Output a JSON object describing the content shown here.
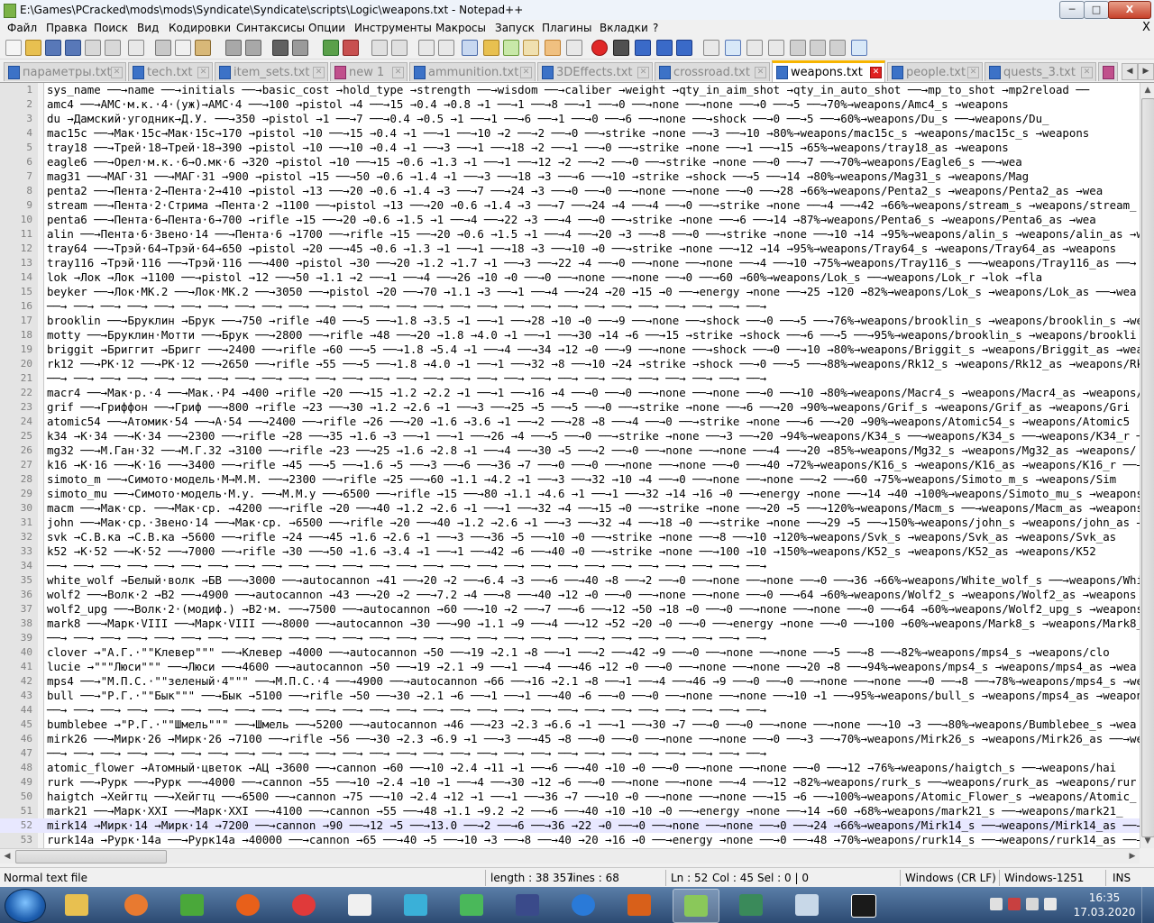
{
  "window": {
    "title": "E:\\Games\\PCracked\\mods\\mods\\Syndicate\\Syndicate\\scripts\\Logic\\weapons.txt - Notepad++",
    "min_label": "─",
    "max_label": "□",
    "close_label": "X"
  },
  "menu": [
    "Файл",
    "Правка",
    "Поиск",
    "Вид",
    "Кодировки",
    "Синтаксисы",
    "Опции",
    "Инструменты",
    "Макросы",
    "Запуск",
    "Плагины",
    "Вкладки",
    "?"
  ],
  "menu_close": "X",
  "tabs": [
    {
      "label": "параметры.txt",
      "modified": false,
      "active": false
    },
    {
      "label": "tech.txt",
      "modified": false,
      "active": false
    },
    {
      "label": "item_sets.txt",
      "modified": false,
      "active": false
    },
    {
      "label": "new 1",
      "modified": true,
      "active": false
    },
    {
      "label": "ammunition.txt",
      "modified": false,
      "active": false
    },
    {
      "label": "3DEffects.txt",
      "modified": false,
      "active": false
    },
    {
      "label": "crossroad.txt",
      "modified": false,
      "active": false
    },
    {
      "label": "weapons.txt",
      "modified": false,
      "active": true
    },
    {
      "label": "people.txt",
      "modified": false,
      "active": false
    },
    {
      "label": "quests_3.txt",
      "modified": false,
      "active": false
    }
  ],
  "lines": [
    "sys_name ──→name ──→initials ──→basic_cost →hold_type →strength ──→wisdom ──→caliber →weight →qty_in_aim_shot →qty_in_auto_shot ──→mp_to_shot →mp2reload ──",
    "amc4 ──→AMC·м.к.·4·(уж)→AMC·4 ──→100 →pistol →4 ──→15 →0.4 →0.8 →1 ──→1 ──→8 ──→1 ──→0 ──→none ──→none ──→0 ──→5 ──→70%→weapons/Amc4_s →weapons",
    "du →Дамский·угодник→Д.У. ──→350 →pistol →1 ──→7 ──→0.4 →0.5 →1 ──→1 ──→6 ──→1 ──→0 ──→6 ──→none ──→shock ──→0 ──→5 ──→60%→weapons/Du_s ──→weapons/Du_",
    "mac15c ──→Мак·15с→Мак·15с→170 →pistol →10 ──→15 →0.4 →1 ──→1 ──→10 →2 ──→2 ──→0 ──→strike →none ──→3 ──→10 →80%→weapons/mac15c_s →weapons/mac15c_s →weapons",
    "tray18 ──→Трей·18→Трей·18→390 →pistol →10 ──→10 →0.4 →1 ──→3 ──→1 ──→18 →2 ──→1 ──→0 ──→strike →none ──→1 ──→15 →65%→weapons/tray18_as →weapons",
    "eagle6 ──→Орел·м.к.·6→О.мк·6 →320 →pistol →10 ──→15 →0.6 →1.3 →1 ──→1 ──→12 →2 ──→2 ──→0 ──→strike →none ──→0 ──→7 ──→70%→weapons/Eagle6_s ──→wea",
    "mag31 ──→МАГ·31 ──→МАГ·31 →900 →pistol →15 ──→50 →0.6 →1.4 →1 ──→3 ──→18 →3 ──→6 ──→10 →strike →shock ──→5 ──→14 →80%→weapons/Mag31_s →weapons/Mag",
    "penta2 ──→Пента·2→Пента·2→410 →pistol →13 ──→20 →0.6 →1.4 →3 ──→7 ──→24 →3 ──→0 ──→0 ──→none ──→none ──→0 ──→28 →66%→weapons/Penta2_s →weapons/Penta2_as →wea",
    "stream ──→Пента·2·Стрима →Пента·2 →1100 ──→pistol →13 ──→20 →0.6 →1.4 →3 ──→7 ──→24 →4 ──→4 ──→0 ──→strike →none ──→4 ──→42 →66%→weapons/stream_s →weapons/stream_",
    "penta6 ──→Пента·6→Пента·6→700 →rifle →15 ──→20 →0.6 →1.5 →1 ──→4 ──→22 →3 ──→4 ──→0 ──→strike →none ──→6 ──→14 →87%→weapons/Penta6_s →weapons/Penta6_as →wea",
    "alin ──→Пента·6·Звено·14 ──→Пента·6 →1700 ──→rifle →15 ──→20 →0.6 →1.5 →1 ──→4 ──→20 →3 ──→8 ──→0 ──→strike →none ──→10 →14 →95%→weapons/alin_s →weapons/alin_as →wea",
    "tray64 ──→Трэй·64→Трэй·64→650 →pistol →20 ──→45 →0.6 →1.3 →1 ──→1 ──→18 →3 ──→10 →0 ──→strike →none ──→12 →14 →95%→weapons/Tray64_s →weapons/Tray64_as →weapons",
    "tray116 →Трэй·116 ──→Трэй·116 ──→400 →pistol →30 ──→20 →1.2 →1.7 →1 ──→3 ──→22 →4 ──→0 ──→none ──→none ──→4 ──→10 →75%→weapons/Tray116_s ──→weapons/Tray116_as ──→",
    "lok →Лок →Лок →1100 ──→pistol →12 ──→50 →1.1 →2 ──→1 ──→4 ──→26 →10 →0 ──→0 ──→none ──→none ──→0 ──→60 →60%→weapons/Lok_s ──→weapons/Lok_r →lok →fla",
    "beyker ──→Лок·МК.2 ──→Лок·МК.2 ──→3050 ──→pistol →20 ──→70 →1.1 →3 ──→1 ──→4 ──→24 →20 →15 →0 ──→energy →none ──→25 →120 →82%→weapons/Lok_s →weapons/Lok_as ──→wea",
    "──→ ──→ ──→ ──→ ──→ ──→ ──→ ──→ ──→ ──→ ──→ ──→ ──→ ──→ ──→ ──→ ──→ ──→ ──→ ──→ ──→ ──→ ──→ ──→ ──→ ──→ ──→",
    "brooklin ──→Бруклин →Брук ──→750 →rifle →40 ──→5 ──→1.8 →3.5 →1 ──→1 ──→28 →10 →0 ──→9 ──→none ──→shock ──→0 ──→5 ──→76%→weapons/brooklin_s →weapons/brooklin_s →wea",
    "motty ──→Бруклин·Мотти ──→Брук ──→2800 ──→rifle →48 ──→20 →1.8 →4.0 →1 ──→1 ──→30 →14 →6 ──→15 →strike →shock ──→6 ──→5 ──→95%→weapons/brooklin_s →weapons/brookli",
    "briggit →Бриггит →Бригг ──→2400 ──→rifle →60 ──→5 ──→1.8 →5.4 →1 ──→4 ──→34 →12 →0 ──→9 ──→none ──→shock ──→0 ──→10 →80%→weapons/Briggit_s →weapons/Briggit_as →wea",
    "rk12 ──→РК·12 ──→РК·12 ──→2650 ──→rifle →55 ──→5 ──→1.8 →4.0 →1 ──→1 ──→32 →8 ──→10 →24 →strike →shock ──→0 ──→5 ──→88%→weapons/Rk12_s →weapons/Rk12_as →weapons/Rk1",
    "──→ ──→ ──→ ──→ ──→ ──→ ──→ ──→ ──→ ──→ ──→ ──→ ──→ ──→ ──→ ──→ ──→ ──→ ──→ ──→ ──→ ──→ ──→ ──→ ──→ ──→ ──→",
    "macr4 ──→Мак·р.·4 ──→Мак.·P4 →400 →rifle →20 ──→15 →1.2 →2.2 →1 ──→1 ──→16 →4 ──→0 ──→0 ──→none ──→none ──→0 ──→10 →80%→weapons/Macr4_s →weapons/Macr4_as →weapons/Mac",
    "grif ──→Гриффон ──→Гриф ──→800 →rifle →23 ──→30 →1.2 →2.6 →1 ──→3 ──→25 →5 ──→5 ──→0 ──→strike →none ──→6 ──→20 →90%→weapons/Grif_s →weapons/Grif_as →weapons/Gri",
    "atomic54 ──→Атомик·54 ──→А·54 ──→2400 ──→rifle →26 ──→20 →1.6 →3.6 →1 ──→2 ──→28 →8 ──→4 ──→0 ──→strike →none ──→6 ──→20 →90%→weapons/Atomic54_s →weapons/Atomic5",
    "k34 →К·34 ──→К·34 ──→2300 ──→rifle →28 ──→35 →1.6 →3 ──→1 ──→1 ──→26 →4 ──→5 ──→0 ──→strike →none ──→3 ──→20 →94%→weapons/K34_s ──→weapons/K34_s ──→weapons/K34_r ──→",
    "mg32 ──→М.Ган·32 ──→М.Г.32 →3100 ──→rifle →23 ──→25 →1.6 →2.8 →1 ──→4 ──→30 →5 ──→2 ──→0 ──→none ──→none ──→4 ──→20 →85%→weapons/Mg32_s →weapons/Mg32_as →weapons/",
    "k16 →К·16 ──→К·16 ──→3400 ──→rifle →45 ──→5 ──→1.6 →5 ──→3 ──→6 ──→36 →7 ──→0 ──→0 ──→none ──→none ──→0 ──→40 →72%→weapons/K16_s →weapons/K16_as →weapons/K16_r ──→",
    "simoto_m ──→Симото·модель·М→М.М. ──→2300 ──→rifle →25 ──→60 →1.1 →4.2 →1 ──→3 ──→32 →10 →4 ──→0 ──→none ──→none ──→2 ──→60 →75%→weapons/Simoto_m_s →weapons/Sim",
    "simoto_mu ──→Симото·модель·М.у. ──→М.М.у ──→6500 ──→rifle →15 ──→80 →1.1 →4.6 →1 ──→1 ──→32 →14 →16 →0 ──→energy →none ──→14 →40 →100%→weapons/Simoto_mu_s →weapons",
    "macm ──→Мак·ср. ──→Мак·ср. →4200 ──→rifle →20 ──→40 →1.2 →2.6 →1 ──→1 ──→32 →4 ──→15 →0 ──→strike →none ──→20 →5 ──→120%→weapons/Macm_s ──→weapons/Macm_as →weapons",
    "john ──→Мак·ср.·Звено·14 ──→Мак·ср. →6500 ──→rifle →20 ──→40 →1.2 →2.6 →1 ──→3 ──→32 →4 ──→18 →0 ──→strike →none ──→29 →5 ──→150%→weapons/john_s →weapons/john_as →weapons/joh",
    "svk →С.В.ка →С.В.ка →5600 ──→rifle →24 ──→45 →1.6 →2.6 →1 ──→3 ──→36 →5 ──→10 →0 ──→strike →none ──→8 ──→10 →120%→weapons/Svk_s →weapons/Svk_as →weapons/Svk_as",
    "k52 →К·52 ──→К·52 ──→7000 ──→rifle →30 ──→50 →1.6 →3.4 →1 ──→1 ──→42 →6 ──→40 →0 ──→strike →none ──→100 →10 →150%→weapons/K52_s →weapons/K52_as →weapons/K52",
    "──→ ──→ ──→ ──→ ──→ ──→ ──→ ──→ ──→ ──→ ──→ ──→ ──→ ──→ ──→ ──→ ──→ ──→ ──→ ──→ ──→ ──→ ──→ ──→ ──→ ──→ ──→",
    "white_wolf →Белый·волк →БВ ──→3000 ──→autocannon →41 ──→20 →2 ──→6.4 →3 ──→6 ──→40 →8 ──→2 ──→0 ──→none ──→none ──→0 ──→36 →66%→weapons/White_wolf_s ──→weapons/Whi",
    "wolf2 ──→Волк·2 →B2 ──→4900 ──→autocannon →43 ──→20 →2 ──→7.2 →4 ──→8 ──→40 →12 →0 ──→0 ──→none ──→none ──→0 ──→64 →60%→weapons/Wolf2_s →weapons/Wolf2_as →weapons",
    "wolf2_upg ──→Волк·2·(модиф.) →В2·м. ──→7500 ──→autocannon →60 ──→10 →2 ──→7 ──→6 ──→12 →50 →18 →0 ──→0 ──→none ──→none ──→0 ──→64 →60%→weapons/Wolf2_upg_s →weapons",
    "mark8 ──→Марк·VIII ──→Марк·VIII ──→8000 ──→autocannon →30 ──→90 →1.1 →9 ──→4 ──→12 →52 →20 →0 ──→0 ──→energy →none ──→0 ──→100 →60%→weapons/Mark8_s →weapons/Mark8_a",
    "──→ ──→ ──→ ──→ ──→ ──→ ──→ ──→ ──→ ──→ ──→ ──→ ──→ ──→ ──→ ──→ ──→ ──→ ──→ ──→ ──→ ──→ ──→ ──→ ──→ ──→ ──→",
    "clover →\"А.Г.·\"\"Клевер\"\"\" ──→Клевер →4000 ──→autocannon →50 ──→19 →2.1 →8 ──→1 ──→2 ──→42 →9 ──→0 ──→none ──→none ──→5 ──→8 ──→82%→weapons/mps4_s →weapons/clo",
    "lucie →\"\"\"Люси\"\"\" ──→Люси ──→4600 ──→autocannon →50 ──→19 →2.1 →9 ──→1 ──→4 ──→46 →12 →0 ──→0 ──→none ──→none ──→20 →8 ──→94%→weapons/mps4_s →weapons/mps4_as →wea",
    "mps4 ──→\"М.П.С.·\"\"зеленый·4\"\"\" ──→М.П.С.·4 ──→4900 ──→autocannon →66 ──→16 →2.1 →8 ──→1 ──→4 ──→46 →9 ──→0 ──→0 ──→none ──→none ──→0 ──→8 ──→78%→weapons/mps4_s →wea",
    "bull ──→\"Р.Г.·\"\"Бык\"\"\" ──→Бык →5100 ──→rifle →50 ──→30 →2.1 →6 ──→1 ──→1 ──→40 →6 ──→0 ──→0 ──→none ──→none ──→10 →1 ──→95%→weapons/bull_s →weapons/mps4_as →weapons",
    "──→ ──→ ──→ ──→ ──→ ──→ ──→ ──→ ──→ ──→ ──→ ──→ ──→ ──→ ──→ ──→ ──→ ──→ ──→ ──→ ──→ ──→ ──→ ──→ ──→ ──→ ──→",
    "bumblebee →\"Р.Г.·\"\"Шмель\"\"\" ──→Шмель ──→5200 ──→autocannon →46 ──→23 →2.3 →6.6 →1 ──→1 ──→30 →7 ──→0 ──→0 ──→none ──→none ──→10 →3 ──→80%→weapons/Bumblebee_s →wea",
    "mirk26 ──→Мирк·26 →Мирк·26 →7100 ──→rifle →56 ──→30 →2.3 →6.9 →1 ──→3 ──→45 →8 ──→0 ──→0 ──→none ──→none ──→0 ──→3 ──→70%→weapons/Mirk26_s →weapons/Mirk26_as ──→wea",
    "──→ ──→ ──→ ──→ ──→ ──→ ──→ ──→ ──→ ──→ ──→ ──→ ──→ ──→ ──→ ──→ ──→ ──→ ──→ ──→ ──→ ──→ ──→ ──→ ──→ ──→ ──→",
    "atomic_flower →Атомный·цветок →АЦ →3600 ──→cannon →60 ──→10 →2.4 →11 →1 ──→6 ──→40 →10 →0 ──→0 ──→none ──→none ──→0 ──→12 →76%→weapons/haigtch_s ──→weapons/hai",
    "rurk ──→Рурк ──→Рурк ──→4000 ──→cannon →55 ──→10 →2.4 →10 →1 ──→4 ──→30 →12 →6 ──→0 ──→none ──→none ──→4 ──→12 →82%→weapons/rurk_s ──→weapons/rurk_as →weapons/rur",
    "haigtch →Хейгтц ──→Хейгтц ──→6500 ──→cannon →75 ──→10 →2.4 →12 →1 ──→1 ──→36 →7 ──→10 →0 ──→none ──→none ──→15 →6 ──→100%→weapons/Atomic_Flower_s →weapons/Atomic_",
    "mark21 ──→Марк·XXI ──→Марк·XXI ──→4100 ──→cannon →55 ──→48 →1.1 →9.2 →2 ──→6 ──→40 →10 →10 →0 ──→energy →none ──→14 →60 →68%→weapons/mark21_s ──→weapons/mark21_",
    "mirk14 →Мирк·14 →Мирк·14 →7200 ──→cannon →90 ──→12 →5 ──→13.0 ──→2 ──→6 ──→36 →22 →0 ──→0 ──→none ──→none ──→0 ──→24 →66%→weapons/Mirk14_s ──→weapons/Mirk14_as ──→",
    "rurk14a →Рурк·14а ──→Рурк14а →40000 ──→cannon →65 ──→40 →5 ──→10 →3 ──→8 ──→40 →20 →16 →0 ──→energy →none ──→0 ──→48 →70%→weapons/rurk14_s ──→weapons/rurk14_as ──→"
  ],
  "first_line_number": 1,
  "current_line": 52,
  "status": {
    "type": "Normal text file",
    "length": "length : 38 357",
    "lines": "lines : 68",
    "pos": "Ln : 52",
    "col": "Col : 45",
    "sel": "Sel : 0 | 0",
    "eol": "Windows (CR LF)",
    "encoding": "Windows-1251",
    "ins": "INS"
  },
  "clock": {
    "time": "16:35",
    "date": "17.03.2020"
  },
  "colors": {
    "accent": "#f7b500",
    "tab_close_active": "#e02020",
    "current_line_bg": "#e8e8ff"
  }
}
